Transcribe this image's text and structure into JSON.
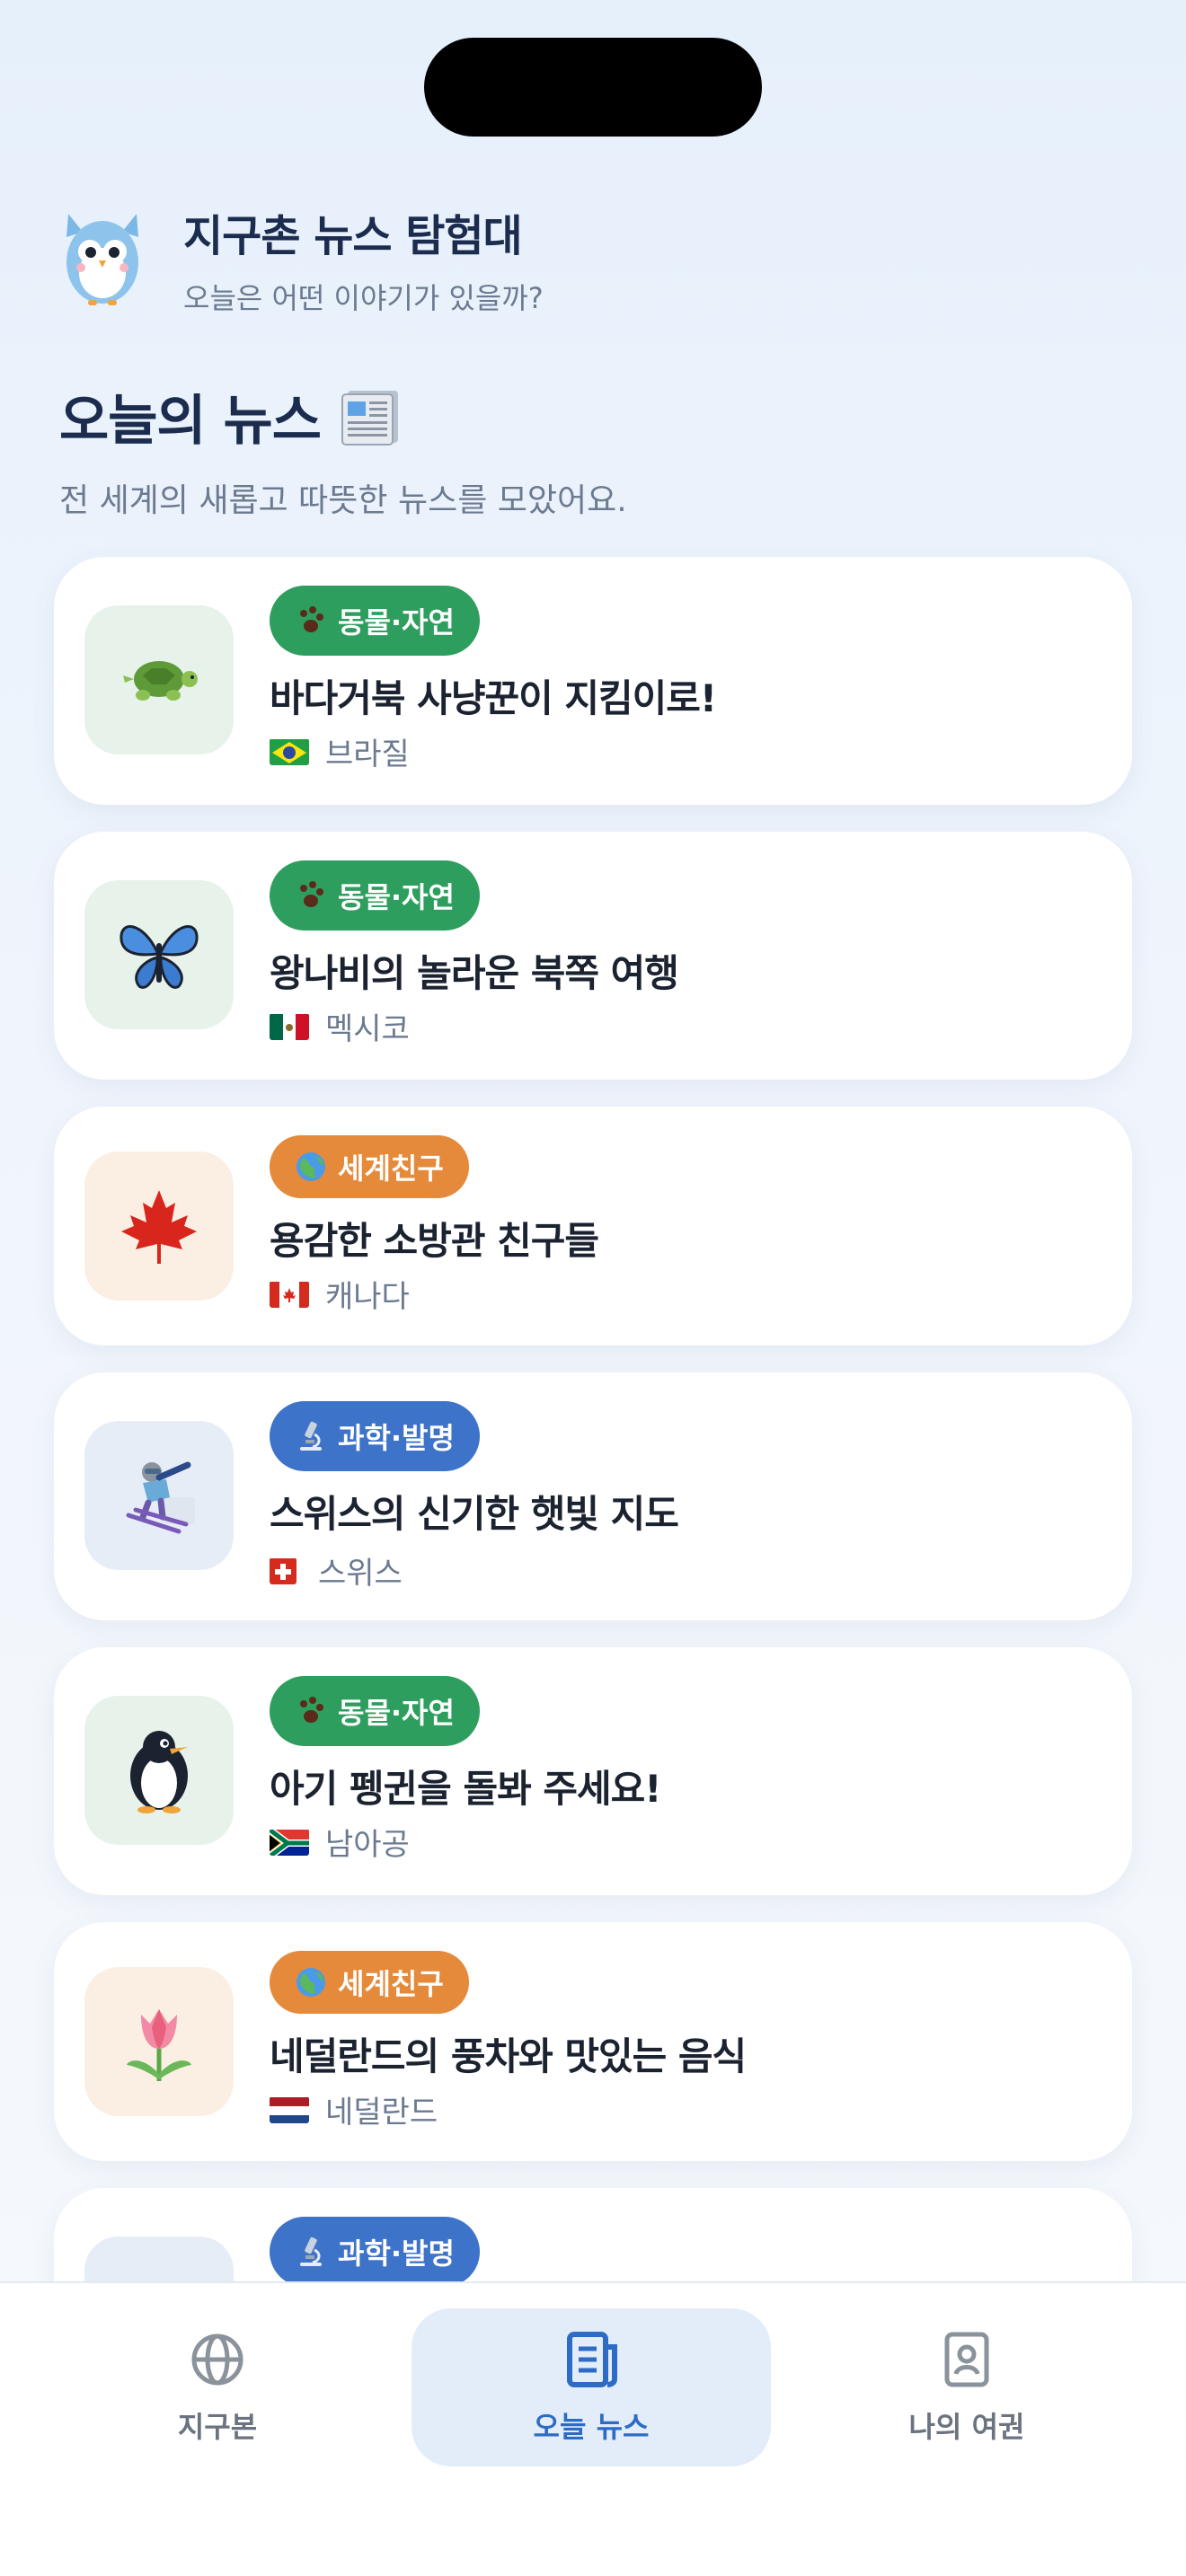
{
  "header": {
    "app_title": "지구촌 뉴스 탐험대",
    "app_subtitle": "오늘은 어떤 이야기가 있을까?",
    "mascot_icon": "owl-icon"
  },
  "section": {
    "title": "오늘의 뉴스",
    "title_icon": "newspaper-icon",
    "description": "전 세계의 새롭고 따뜻한 뉴스를 모았어요."
  },
  "news": [
    {
      "category": "동물·자연",
      "category_icon": "paw-icon",
      "title": "바다거북 사냥꾼이 지킴이로!",
      "country": "브라질",
      "country_flag": "brazil-flag-icon",
      "thumb_icon": "turtle-icon"
    },
    {
      "category": "동물·자연",
      "category_icon": "paw-icon",
      "title": "왕나비의 놀라운 북쪽 여행",
      "country": "멕시코",
      "country_flag": "mexico-flag-icon",
      "thumb_icon": "butterfly-icon"
    },
    {
      "category": "세계친구",
      "category_icon": "globe-icon",
      "title": "용감한 소방관 친구들",
      "country": "캐나다",
      "country_flag": "canada-flag-icon",
      "thumb_icon": "maple-leaf-icon"
    },
    {
      "category": "과학·발명",
      "category_icon": "microscope-icon",
      "title": "스위스의 신기한 햇빛 지도",
      "country": "스위스",
      "country_flag": "switzerland-flag-icon",
      "thumb_icon": "skier-icon"
    },
    {
      "category": "동물·자연",
      "category_icon": "paw-icon",
      "title": "아기 펭귄을 돌봐 주세요!",
      "country": "남아공",
      "country_flag": "south-africa-flag-icon",
      "thumb_icon": "penguin-icon"
    },
    {
      "category": "세계친구",
      "category_icon": "globe-icon",
      "title": "네덜란드의 풍차와 맛있는 음식",
      "country": "네덜란드",
      "country_flag": "netherlands-flag-icon",
      "thumb_icon": "tulip-icon"
    },
    {
      "category": "과학·발명",
      "category_icon": "microscope-icon",
      "title": "",
      "country": "",
      "country_flag": "",
      "thumb_icon": ""
    }
  ],
  "tabs": [
    {
      "label": "지구본",
      "icon": "globe-outline-icon",
      "active": false
    },
    {
      "label": "오늘 뉴스",
      "icon": "document-icon",
      "active": true
    },
    {
      "label": "나의 여권",
      "icon": "passport-icon",
      "active": false
    }
  ],
  "colors": {
    "nature": "#2e9e5e",
    "friend": "#e58a3a",
    "science": "#3d73c8",
    "active_tab": "#2d6cc4"
  }
}
